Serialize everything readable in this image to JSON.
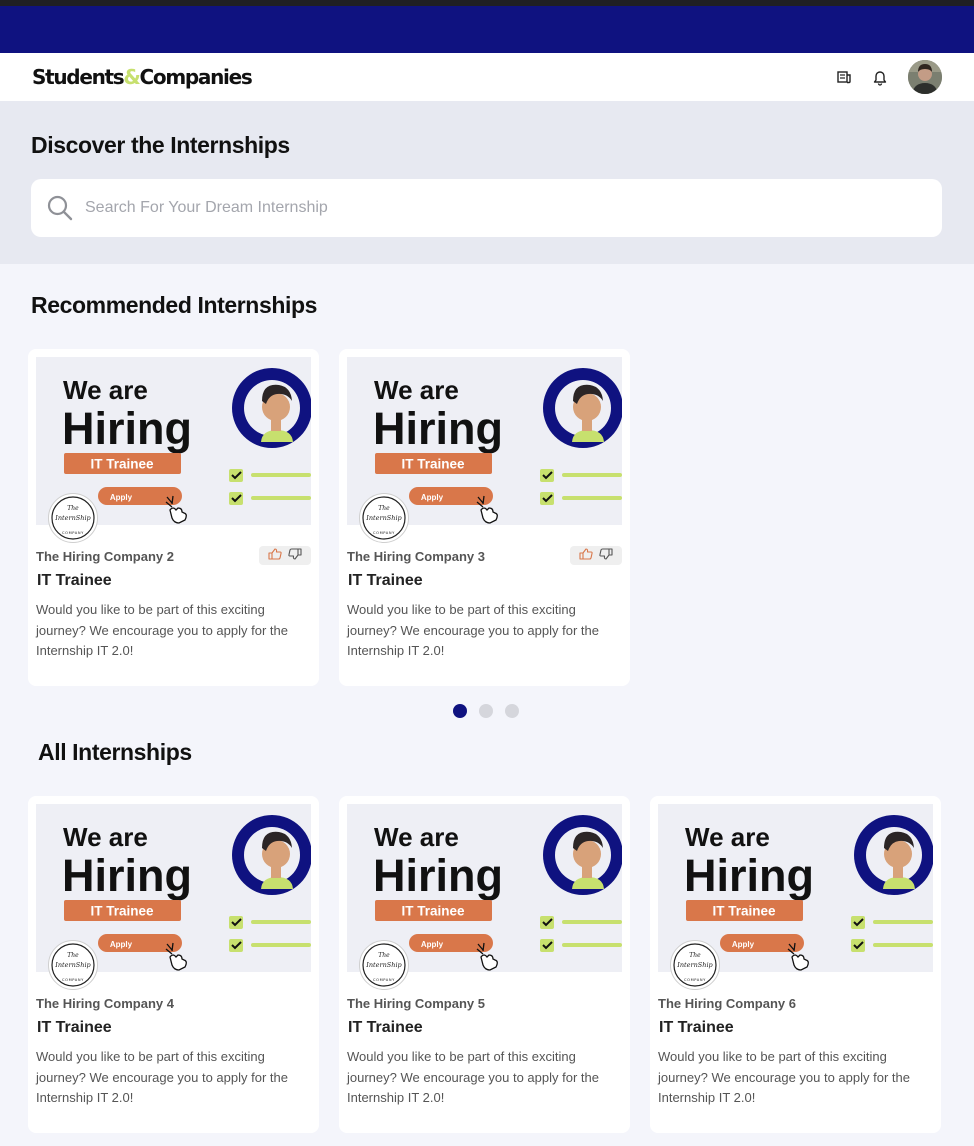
{
  "brand": {
    "logo_part1": "Students",
    "logo_amp": "&",
    "logo_part2": "Companies"
  },
  "header_icons": [
    "news-icon",
    "bell-icon",
    "user-avatar"
  ],
  "discover": {
    "title": "Discover the Internships",
    "search_placeholder": "Search For Your Dream Internship"
  },
  "recommended": {
    "title": "Recommended Internships",
    "cards": [
      {
        "company": "The Hiring Company 2",
        "role": "IT Trainee",
        "description": "Would you like to be part of this exciting journey? We encourage you to apply for the Internship IT 2.0!"
      },
      {
        "company": "The Hiring Company 3",
        "role": "IT Trainee",
        "description": "Would you like to be part of this exciting journey? We encourage you to apply for the Internship IT 2.0!"
      }
    ],
    "pagination": {
      "pages": 3,
      "active": 1
    }
  },
  "all": {
    "title": "All Internships",
    "cards": [
      {
        "company": "The Hiring Company 4",
        "role": "IT Trainee",
        "description": "Would you like to be part of this exciting journey? We encourage you to apply for the Internship IT 2.0!"
      },
      {
        "company": "The Hiring Company 5",
        "role": "IT Trainee",
        "description": "Would you like to be part of this exciting journey? We encourage you to apply for the Internship IT 2.0!"
      },
      {
        "company": "The Hiring Company 6",
        "role": "IT Trainee",
        "description": "Would you like to be part of this exciting journey? We encourage you to apply for the Internship IT 2.0!"
      }
    ]
  },
  "banner": {
    "line1": "We are",
    "line2": "Hiring",
    "badge": "IT Trainee",
    "button": "Apply"
  },
  "company_logo": {
    "line1": "The",
    "line2": "InternShip",
    "line3": "COMPANY"
  },
  "colors": {
    "nav_band": "#0f1280",
    "accent_lime": "#c7e06e",
    "banner_orange": "#d9774a",
    "page_bg": "#f4f5fb"
  }
}
